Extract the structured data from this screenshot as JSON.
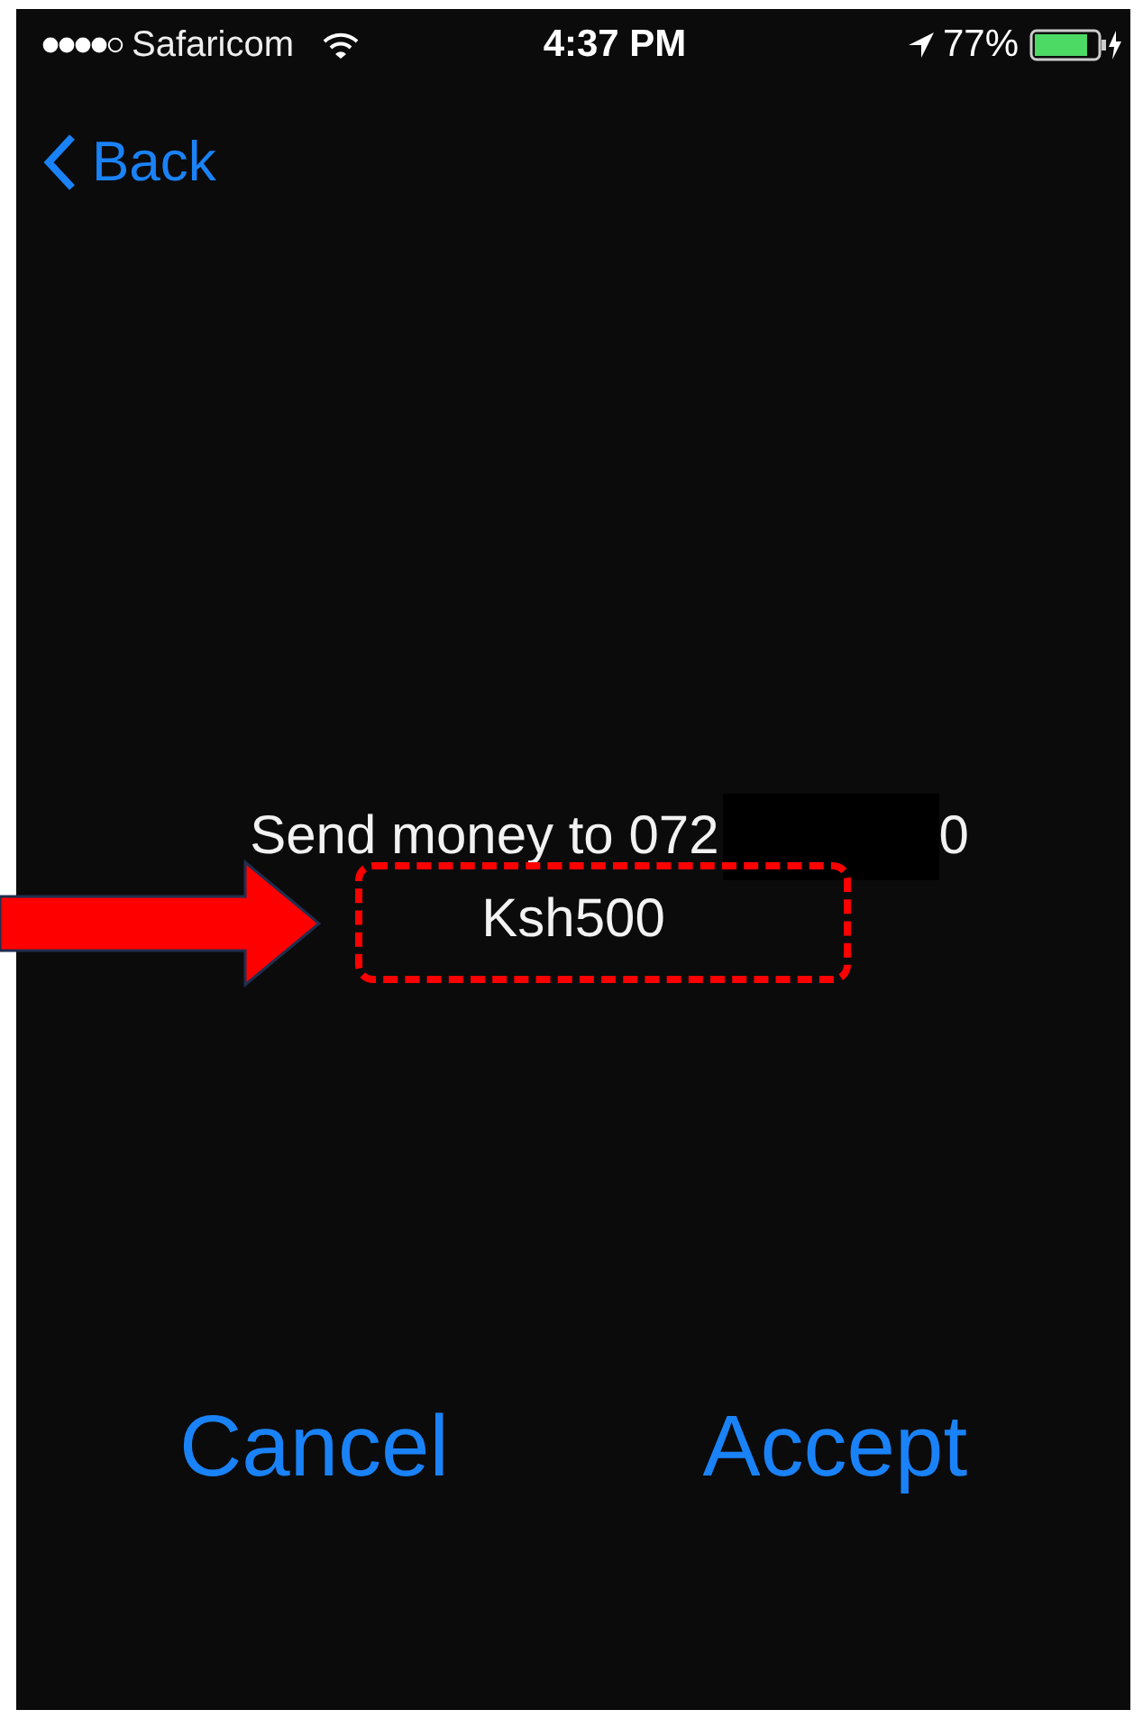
{
  "status_bar": {
    "carrier": "Safaricom",
    "time": "4:37 PM",
    "battery": "77%"
  },
  "nav": {
    "back": "Back"
  },
  "message": {
    "text_before": "Send money to 072",
    "text_after": "0",
    "amount": "Ksh500"
  },
  "buttons": [
    {
      "label": "Cancel"
    },
    {
      "label": "Accept"
    }
  ]
}
